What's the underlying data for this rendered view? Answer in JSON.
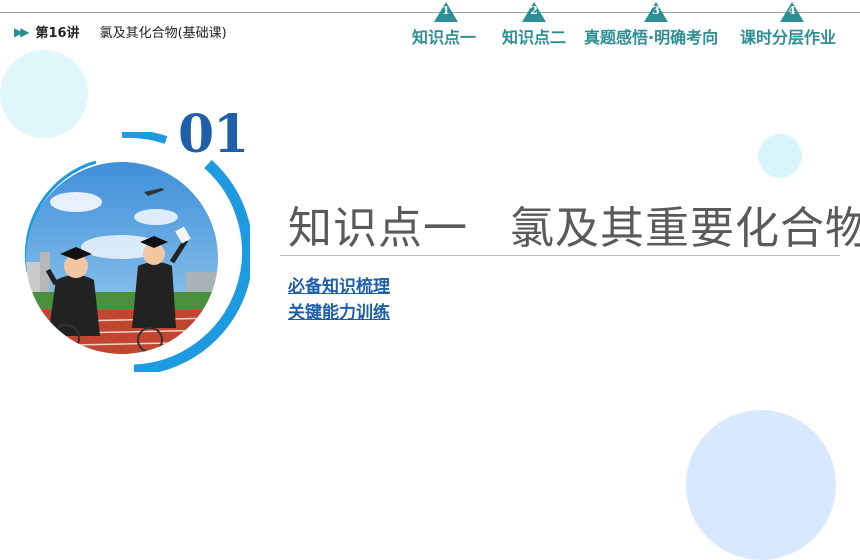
{
  "header": {
    "lesson_number": "第16讲",
    "lesson_title": "氯及其化合物(基础课)"
  },
  "nav": [
    {
      "num": "1",
      "label": "知识点一"
    },
    {
      "num": "2",
      "label": "知识点二"
    },
    {
      "num": "3",
      "label": "真题感悟·明确考向"
    },
    {
      "num": "4",
      "label": "课时分层作业"
    }
  ],
  "section": {
    "number": "01",
    "title_left": "知识点一",
    "title_right": "氯及其重要化合物"
  },
  "links": [
    "必备知识梳理",
    "关键能力训练"
  ],
  "colors": {
    "teal": "#2e8e95",
    "blue": "#1f5ea8",
    "ring": "#1e9be0"
  }
}
